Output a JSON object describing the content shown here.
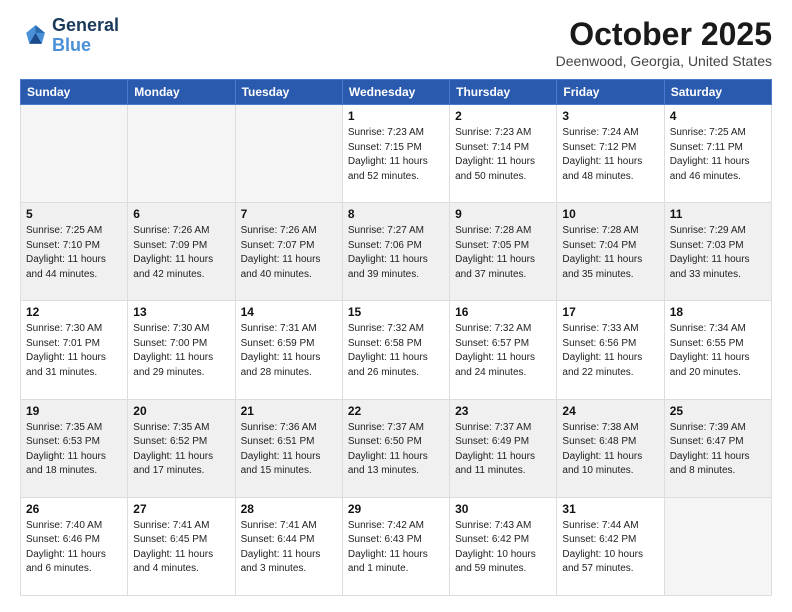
{
  "header": {
    "logo_line1": "General",
    "logo_line2": "Blue",
    "month": "October 2025",
    "location": "Deenwood, Georgia, United States"
  },
  "days_of_week": [
    "Sunday",
    "Monday",
    "Tuesday",
    "Wednesday",
    "Thursday",
    "Friday",
    "Saturday"
  ],
  "weeks": [
    [
      {
        "day": "",
        "info": ""
      },
      {
        "day": "",
        "info": ""
      },
      {
        "day": "",
        "info": ""
      },
      {
        "day": "1",
        "info": "Sunrise: 7:23 AM\nSunset: 7:15 PM\nDaylight: 11 hours\nand 52 minutes."
      },
      {
        "day": "2",
        "info": "Sunrise: 7:23 AM\nSunset: 7:14 PM\nDaylight: 11 hours\nand 50 minutes."
      },
      {
        "day": "3",
        "info": "Sunrise: 7:24 AM\nSunset: 7:12 PM\nDaylight: 11 hours\nand 48 minutes."
      },
      {
        "day": "4",
        "info": "Sunrise: 7:25 AM\nSunset: 7:11 PM\nDaylight: 11 hours\nand 46 minutes."
      }
    ],
    [
      {
        "day": "5",
        "info": "Sunrise: 7:25 AM\nSunset: 7:10 PM\nDaylight: 11 hours\nand 44 minutes."
      },
      {
        "day": "6",
        "info": "Sunrise: 7:26 AM\nSunset: 7:09 PM\nDaylight: 11 hours\nand 42 minutes."
      },
      {
        "day": "7",
        "info": "Sunrise: 7:26 AM\nSunset: 7:07 PM\nDaylight: 11 hours\nand 40 minutes."
      },
      {
        "day": "8",
        "info": "Sunrise: 7:27 AM\nSunset: 7:06 PM\nDaylight: 11 hours\nand 39 minutes."
      },
      {
        "day": "9",
        "info": "Sunrise: 7:28 AM\nSunset: 7:05 PM\nDaylight: 11 hours\nand 37 minutes."
      },
      {
        "day": "10",
        "info": "Sunrise: 7:28 AM\nSunset: 7:04 PM\nDaylight: 11 hours\nand 35 minutes."
      },
      {
        "day": "11",
        "info": "Sunrise: 7:29 AM\nSunset: 7:03 PM\nDaylight: 11 hours\nand 33 minutes."
      }
    ],
    [
      {
        "day": "12",
        "info": "Sunrise: 7:30 AM\nSunset: 7:01 PM\nDaylight: 11 hours\nand 31 minutes."
      },
      {
        "day": "13",
        "info": "Sunrise: 7:30 AM\nSunset: 7:00 PM\nDaylight: 11 hours\nand 29 minutes."
      },
      {
        "day": "14",
        "info": "Sunrise: 7:31 AM\nSunset: 6:59 PM\nDaylight: 11 hours\nand 28 minutes."
      },
      {
        "day": "15",
        "info": "Sunrise: 7:32 AM\nSunset: 6:58 PM\nDaylight: 11 hours\nand 26 minutes."
      },
      {
        "day": "16",
        "info": "Sunrise: 7:32 AM\nSunset: 6:57 PM\nDaylight: 11 hours\nand 24 minutes."
      },
      {
        "day": "17",
        "info": "Sunrise: 7:33 AM\nSunset: 6:56 PM\nDaylight: 11 hours\nand 22 minutes."
      },
      {
        "day": "18",
        "info": "Sunrise: 7:34 AM\nSunset: 6:55 PM\nDaylight: 11 hours\nand 20 minutes."
      }
    ],
    [
      {
        "day": "19",
        "info": "Sunrise: 7:35 AM\nSunset: 6:53 PM\nDaylight: 11 hours\nand 18 minutes."
      },
      {
        "day": "20",
        "info": "Sunrise: 7:35 AM\nSunset: 6:52 PM\nDaylight: 11 hours\nand 17 minutes."
      },
      {
        "day": "21",
        "info": "Sunrise: 7:36 AM\nSunset: 6:51 PM\nDaylight: 11 hours\nand 15 minutes."
      },
      {
        "day": "22",
        "info": "Sunrise: 7:37 AM\nSunset: 6:50 PM\nDaylight: 11 hours\nand 13 minutes."
      },
      {
        "day": "23",
        "info": "Sunrise: 7:37 AM\nSunset: 6:49 PM\nDaylight: 11 hours\nand 11 minutes."
      },
      {
        "day": "24",
        "info": "Sunrise: 7:38 AM\nSunset: 6:48 PM\nDaylight: 11 hours\nand 10 minutes."
      },
      {
        "day": "25",
        "info": "Sunrise: 7:39 AM\nSunset: 6:47 PM\nDaylight: 11 hours\nand 8 minutes."
      }
    ],
    [
      {
        "day": "26",
        "info": "Sunrise: 7:40 AM\nSunset: 6:46 PM\nDaylight: 11 hours\nand 6 minutes."
      },
      {
        "day": "27",
        "info": "Sunrise: 7:41 AM\nSunset: 6:45 PM\nDaylight: 11 hours\nand 4 minutes."
      },
      {
        "day": "28",
        "info": "Sunrise: 7:41 AM\nSunset: 6:44 PM\nDaylight: 11 hours\nand 3 minutes."
      },
      {
        "day": "29",
        "info": "Sunrise: 7:42 AM\nSunset: 6:43 PM\nDaylight: 11 hours\nand 1 minute."
      },
      {
        "day": "30",
        "info": "Sunrise: 7:43 AM\nSunset: 6:42 PM\nDaylight: 10 hours\nand 59 minutes."
      },
      {
        "day": "31",
        "info": "Sunrise: 7:44 AM\nSunset: 6:42 PM\nDaylight: 10 hours\nand 57 minutes."
      },
      {
        "day": "",
        "info": ""
      }
    ]
  ]
}
